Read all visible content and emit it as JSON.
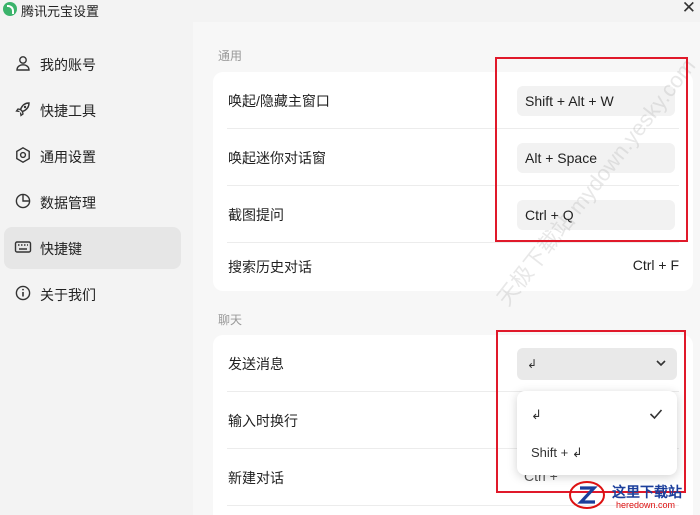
{
  "window": {
    "title": "腾讯元宝设置",
    "close_glyph": "✕"
  },
  "sidebar": {
    "items": [
      {
        "label": "我的账号",
        "icon": "user-icon"
      },
      {
        "label": "快捷工具",
        "icon": "rocket-icon"
      },
      {
        "label": "通用设置",
        "icon": "hexagon-settings-icon"
      },
      {
        "label": "数据管理",
        "icon": "pie-chart-icon"
      },
      {
        "label": "快捷键",
        "icon": "keyboard-icon",
        "active": true
      },
      {
        "label": "关于我们",
        "icon": "info-icon"
      }
    ]
  },
  "general": {
    "section_title": "通用",
    "rows": [
      {
        "label": "唤起/隐藏主窗口",
        "shortcut": "Shift + Alt + W"
      },
      {
        "label": "唤起迷你对话窗",
        "shortcut": "Alt + Space"
      },
      {
        "label": "截图提问",
        "shortcut": "Ctrl + Q"
      },
      {
        "label": "搜索历史对话",
        "shortcut": "Ctrl + F"
      }
    ]
  },
  "chat": {
    "section_title": "聊天",
    "rows": [
      {
        "label": "发送消息"
      },
      {
        "label": "输入时换行"
      },
      {
        "label": "新建对话"
      }
    ],
    "send_select": {
      "value": "↲",
      "options": [
        {
          "label": "↲",
          "selected": true
        },
        {
          "label": "Shift + ↲",
          "selected": false
        }
      ]
    },
    "newchat_partial": "Ctrl +"
  },
  "watermark": "天极下载站 mydown.yesky.com",
  "site_badge": {
    "title": "这里下载站",
    "url": "heredown.com"
  },
  "colors": {
    "highlight_red": "#e0192a",
    "logo_green": "#3bb36b"
  }
}
